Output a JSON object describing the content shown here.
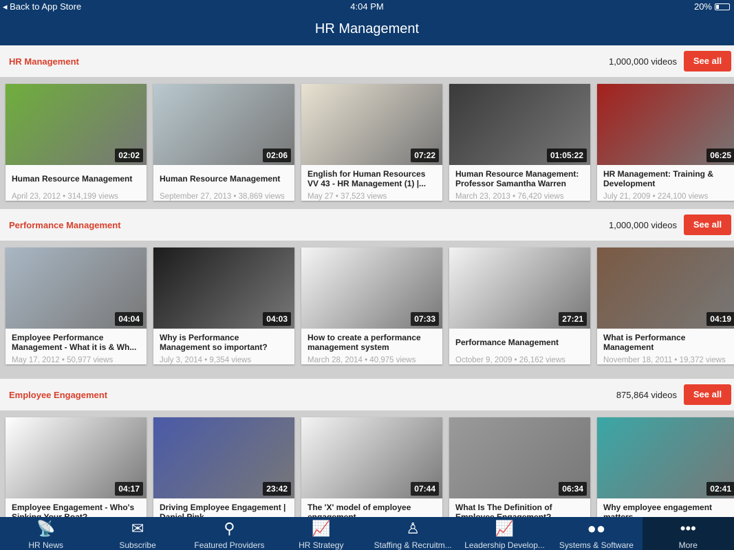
{
  "status": {
    "back": "Back to App Store",
    "time": "4:04 PM",
    "battery": "20%",
    "battery_level": 0.2
  },
  "header": {
    "title": "HR Management"
  },
  "sections": [
    {
      "name": "HR Management",
      "count": "1,000,000 videos",
      "see_all": "See all",
      "videos": [
        {
          "title": "Human Resource Management",
          "meta": "April 23, 2012 • 314,199 views",
          "duration": "02:02",
          "color": "#6fae3c"
        },
        {
          "title": "Human Resource Management",
          "meta": "September 27, 2013 • 38,869 views",
          "duration": "02:06",
          "color": "#b9c9cf"
        },
        {
          "title": "English for Human Resources VV 43 - HR Management (1) |...",
          "meta": "May 27 • 37,523 views",
          "duration": "07:22",
          "color": "#e9e2d2"
        },
        {
          "title": "Human Resource Management: Professor Samantha Warren",
          "meta": "March 23, 2013 • 76,420 views",
          "duration": "01:05:22",
          "color": "#3a3a3a"
        },
        {
          "title": "HR Management: Training & Development",
          "meta": "July 21, 2009 • 224,100 views",
          "duration": "06:25",
          "color": "#a4201c"
        }
      ]
    },
    {
      "name": "Performance Management",
      "count": "1,000,000 videos",
      "see_all": "See all",
      "videos": [
        {
          "title": "Employee Performance Management - What it is & Wh...",
          "meta": "May 17, 2012 • 50,977 views",
          "duration": "04:04",
          "color": "#a9b7c4"
        },
        {
          "title": "Why is Performance Management so important?",
          "meta": "July 3, 2014 • 9,354 views",
          "duration": "04:03",
          "color": "#1c1c1c"
        },
        {
          "title": "How to create a performance management system",
          "meta": "March 28, 2014 • 40,975 views",
          "duration": "07:33",
          "color": "#f5f5f5"
        },
        {
          "title": "Performance Management",
          "meta": "October 9, 2009 • 26,162 views",
          "duration": "27:21",
          "color": "#f2f2f2"
        },
        {
          "title": "What is Performance Management",
          "meta": "November 18, 2011 • 19,372 views",
          "duration": "04:19",
          "color": "#7a5a44"
        }
      ]
    },
    {
      "name": "Employee Engagement",
      "count": "875,864 videos",
      "see_all": "See all",
      "videos": [
        {
          "title": "Employee Engagement - Who's Sinking Your Boat?",
          "meta": "",
          "duration": "04:17",
          "color": "#ffffff"
        },
        {
          "title": "Driving Employee Engagement | Daniel Pink",
          "meta": "",
          "duration": "23:42",
          "color": "#4a5aa8"
        },
        {
          "title": "The 'X' model of employee engagement",
          "meta": "",
          "duration": "07:44",
          "color": "#f4f4f4"
        },
        {
          "title": "What Is The Definition of Employee Engagement?",
          "meta": "",
          "duration": "06:34",
          "color": "#9a9a9a"
        },
        {
          "title": "Why employee engagement matters",
          "meta": "",
          "duration": "02:41",
          "color": "#3aa7a6"
        }
      ]
    }
  ],
  "tabs": [
    {
      "label": "HR News",
      "icon": "satellite-dish-icon",
      "glyph": "📡"
    },
    {
      "label": "Subscribe",
      "icon": "envelope-icon",
      "glyph": "✉"
    },
    {
      "label": "Featured Providers",
      "icon": "magnifier-icon",
      "glyph": "⚲"
    },
    {
      "label": "HR Strategy",
      "icon": "line-chart-icon",
      "glyph": "📈"
    },
    {
      "label": "Staffing & Recruitm...",
      "icon": "person-icon",
      "glyph": "♙"
    },
    {
      "label": "Leadership Develop...",
      "icon": "line-chart-icon",
      "glyph": "📈"
    },
    {
      "label": "Systems & Software",
      "icon": "two-dots-icon",
      "glyph": "●●"
    },
    {
      "label": "More",
      "icon": "more-icon",
      "glyph": "•••"
    }
  ]
}
